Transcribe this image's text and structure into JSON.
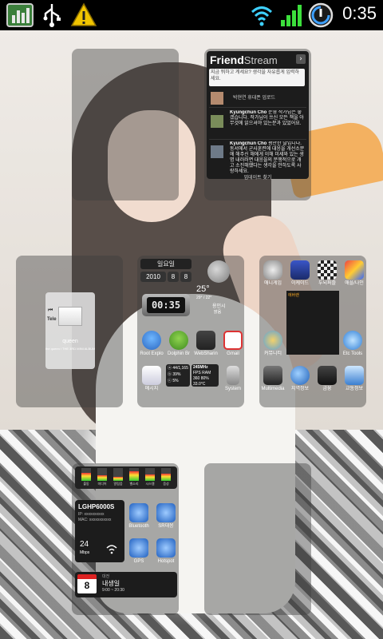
{
  "status_bar": {
    "time": "0:35",
    "icons": [
      "app-monitor-icon",
      "usb-icon",
      "warning-icon",
      "wifi-icon",
      "signal-icon",
      "sync-icon"
    ]
  },
  "friend_stream": {
    "title_bold": "Friend",
    "title_light": "Stream",
    "input_placeholder": "지금 뭐하고 계세요? 생각을 자유롭게 입력하세요.",
    "posts": [
      {
        "text": "박현연 휴대폰 업로드"
      },
      {
        "name": "Kyungchun Cho",
        "text": "운영 작가님은 좋겠습니다. 작가님이 쓰신 모든 책을 아무것에 읽으셔야 있는분과 있었어요."
      },
      {
        "name": "Kyungchun Cho",
        "text": "평안한 날입니다. 동서에서 군사훈련에 대응을 개선소분에 해주신 해에게 이해 미세와 있는 생명 내러러면 대응을의 분쟁적으로 개고 소진해했다는 생각을 안하도록 사랑하세요."
      }
    ],
    "footer": "업데이트 찾기"
  },
  "music_widget": {
    "album_tag": "Tele",
    "track_title": "queen",
    "track_info": "the queen / THE 3RD MINI ALBUM"
  },
  "calendar_widget": {
    "weekday": "일요일",
    "year": "2010",
    "month": "8",
    "day": "8"
  },
  "clock_widget": {
    "time": "00:35"
  },
  "weather_widget": {
    "temp": "25°",
    "range": "29° / 22°",
    "location": "용인시",
    "condition": "맑음"
  },
  "apps_row1": [
    {
      "label": "Root Explo",
      "icon": "folder-globe-icon"
    },
    {
      "label": "Dolphin Br",
      "icon": "dolphin-icon"
    },
    {
      "label": "WebSharin",
      "icon": "web-sharing-icon"
    },
    {
      "label": "Gmail",
      "icon": "gmail-icon"
    }
  ],
  "apps_row2": [
    {
      "label": "메시지",
      "icon": "message-icon"
    },
    {
      "label": "System",
      "icon": "system-icon"
    }
  ],
  "system_widget": {
    "lines": [
      "ⓐ 44/1,165",
      "ⓑ 39%",
      "ⓒ 5%"
    ],
    "freq": "245MHz",
    "fps": "FPS",
    "ram": "RAM",
    "rate": "360",
    "pct": "80%",
    "temp": "33.0°C"
  },
  "right_apps_top": [
    {
      "label": "애니게임",
      "icon": "gamepad-icon"
    },
    {
      "label": "이케이드",
      "icon": "arcade-icon"
    },
    {
      "label": "두뇌퍼즐",
      "icon": "puzzle-icon"
    },
    {
      "label": "애플/나인",
      "icon": "gift-icon"
    }
  ],
  "right_panel_badge": "에버랜",
  "right_apps_mid": [
    {
      "label": "커뮤니티",
      "icon": "community-icon"
    },
    {
      "label": "Etc Tools",
      "icon": "tools-icon"
    }
  ],
  "right_apps_bottom": [
    {
      "label": "Multimedia",
      "icon": "multimedia-icon"
    },
    {
      "label": "지역정보",
      "icon": "globe-icon"
    },
    {
      "label": "금융",
      "icon": "finance-icon"
    },
    {
      "label": "교통정보",
      "icon": "traffic-icon"
    }
  ],
  "eq_widget": {
    "labels": [
      "출동",
      "미디어",
      "알림음",
      "벨소리",
      "시스템",
      "음성"
    ],
    "levels": [
      0.6,
      0.45,
      0.3,
      0.75,
      0.5,
      0.55
    ]
  },
  "wifi_widget": {
    "device": "LGHP6000S",
    "ip": "IP: xxxxxxxxxx",
    "mac": "MAC: xxxxxxxxxxx",
    "speed": "24",
    "speed_unit": "Mbps"
  },
  "toggles": [
    {
      "label": "Bluetooth",
      "icon": "bluetooth-icon"
    },
    {
      "label": "SR대응",
      "icon": "sync-box-icon"
    },
    {
      "label": "GPS",
      "icon": "gps-icon"
    },
    {
      "label": "Hotspot",
      "icon": "hotspot-icon"
    }
  ],
  "agenda_widget": {
    "day": "8",
    "label": "대전",
    "title": "내생일",
    "time": "9:00 ~ 20:30"
  }
}
